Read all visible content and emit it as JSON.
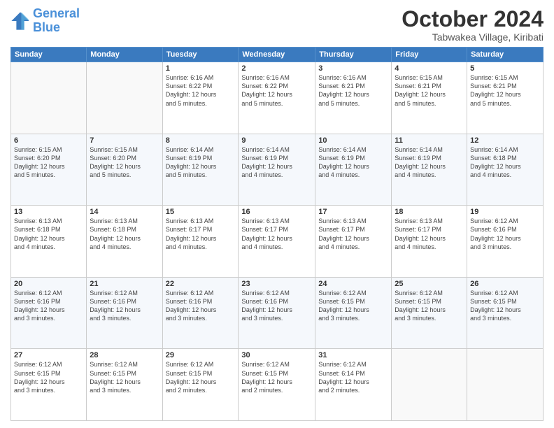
{
  "logo": {
    "line1": "General",
    "line2": "Blue"
  },
  "header": {
    "month": "October 2024",
    "location": "Tabwakea Village, Kiribati"
  },
  "weekdays": [
    "Sunday",
    "Monday",
    "Tuesday",
    "Wednesday",
    "Thursday",
    "Friday",
    "Saturday"
  ],
  "weeks": [
    [
      {
        "day": "",
        "info": ""
      },
      {
        "day": "",
        "info": ""
      },
      {
        "day": "1",
        "info": "Sunrise: 6:16 AM\nSunset: 6:22 PM\nDaylight: 12 hours\nand 5 minutes."
      },
      {
        "day": "2",
        "info": "Sunrise: 6:16 AM\nSunset: 6:22 PM\nDaylight: 12 hours\nand 5 minutes."
      },
      {
        "day": "3",
        "info": "Sunrise: 6:16 AM\nSunset: 6:21 PM\nDaylight: 12 hours\nand 5 minutes."
      },
      {
        "day": "4",
        "info": "Sunrise: 6:15 AM\nSunset: 6:21 PM\nDaylight: 12 hours\nand 5 minutes."
      },
      {
        "day": "5",
        "info": "Sunrise: 6:15 AM\nSunset: 6:21 PM\nDaylight: 12 hours\nand 5 minutes."
      }
    ],
    [
      {
        "day": "6",
        "info": "Sunrise: 6:15 AM\nSunset: 6:20 PM\nDaylight: 12 hours\nand 5 minutes."
      },
      {
        "day": "7",
        "info": "Sunrise: 6:15 AM\nSunset: 6:20 PM\nDaylight: 12 hours\nand 5 minutes."
      },
      {
        "day": "8",
        "info": "Sunrise: 6:14 AM\nSunset: 6:19 PM\nDaylight: 12 hours\nand 5 minutes."
      },
      {
        "day": "9",
        "info": "Sunrise: 6:14 AM\nSunset: 6:19 PM\nDaylight: 12 hours\nand 4 minutes."
      },
      {
        "day": "10",
        "info": "Sunrise: 6:14 AM\nSunset: 6:19 PM\nDaylight: 12 hours\nand 4 minutes."
      },
      {
        "day": "11",
        "info": "Sunrise: 6:14 AM\nSunset: 6:19 PM\nDaylight: 12 hours\nand 4 minutes."
      },
      {
        "day": "12",
        "info": "Sunrise: 6:14 AM\nSunset: 6:18 PM\nDaylight: 12 hours\nand 4 minutes."
      }
    ],
    [
      {
        "day": "13",
        "info": "Sunrise: 6:13 AM\nSunset: 6:18 PM\nDaylight: 12 hours\nand 4 minutes."
      },
      {
        "day": "14",
        "info": "Sunrise: 6:13 AM\nSunset: 6:18 PM\nDaylight: 12 hours\nand 4 minutes."
      },
      {
        "day": "15",
        "info": "Sunrise: 6:13 AM\nSunset: 6:17 PM\nDaylight: 12 hours\nand 4 minutes."
      },
      {
        "day": "16",
        "info": "Sunrise: 6:13 AM\nSunset: 6:17 PM\nDaylight: 12 hours\nand 4 minutes."
      },
      {
        "day": "17",
        "info": "Sunrise: 6:13 AM\nSunset: 6:17 PM\nDaylight: 12 hours\nand 4 minutes."
      },
      {
        "day": "18",
        "info": "Sunrise: 6:13 AM\nSunset: 6:17 PM\nDaylight: 12 hours\nand 4 minutes."
      },
      {
        "day": "19",
        "info": "Sunrise: 6:12 AM\nSunset: 6:16 PM\nDaylight: 12 hours\nand 3 minutes."
      }
    ],
    [
      {
        "day": "20",
        "info": "Sunrise: 6:12 AM\nSunset: 6:16 PM\nDaylight: 12 hours\nand 3 minutes."
      },
      {
        "day": "21",
        "info": "Sunrise: 6:12 AM\nSunset: 6:16 PM\nDaylight: 12 hours\nand 3 minutes."
      },
      {
        "day": "22",
        "info": "Sunrise: 6:12 AM\nSunset: 6:16 PM\nDaylight: 12 hours\nand 3 minutes."
      },
      {
        "day": "23",
        "info": "Sunrise: 6:12 AM\nSunset: 6:16 PM\nDaylight: 12 hours\nand 3 minutes."
      },
      {
        "day": "24",
        "info": "Sunrise: 6:12 AM\nSunset: 6:15 PM\nDaylight: 12 hours\nand 3 minutes."
      },
      {
        "day": "25",
        "info": "Sunrise: 6:12 AM\nSunset: 6:15 PM\nDaylight: 12 hours\nand 3 minutes."
      },
      {
        "day": "26",
        "info": "Sunrise: 6:12 AM\nSunset: 6:15 PM\nDaylight: 12 hours\nand 3 minutes."
      }
    ],
    [
      {
        "day": "27",
        "info": "Sunrise: 6:12 AM\nSunset: 6:15 PM\nDaylight: 12 hours\nand 3 minutes."
      },
      {
        "day": "28",
        "info": "Sunrise: 6:12 AM\nSunset: 6:15 PM\nDaylight: 12 hours\nand 3 minutes."
      },
      {
        "day": "29",
        "info": "Sunrise: 6:12 AM\nSunset: 6:15 PM\nDaylight: 12 hours\nand 2 minutes."
      },
      {
        "day": "30",
        "info": "Sunrise: 6:12 AM\nSunset: 6:15 PM\nDaylight: 12 hours\nand 2 minutes."
      },
      {
        "day": "31",
        "info": "Sunrise: 6:12 AM\nSunset: 6:14 PM\nDaylight: 12 hours\nand 2 minutes."
      },
      {
        "day": "",
        "info": ""
      },
      {
        "day": "",
        "info": ""
      }
    ]
  ]
}
